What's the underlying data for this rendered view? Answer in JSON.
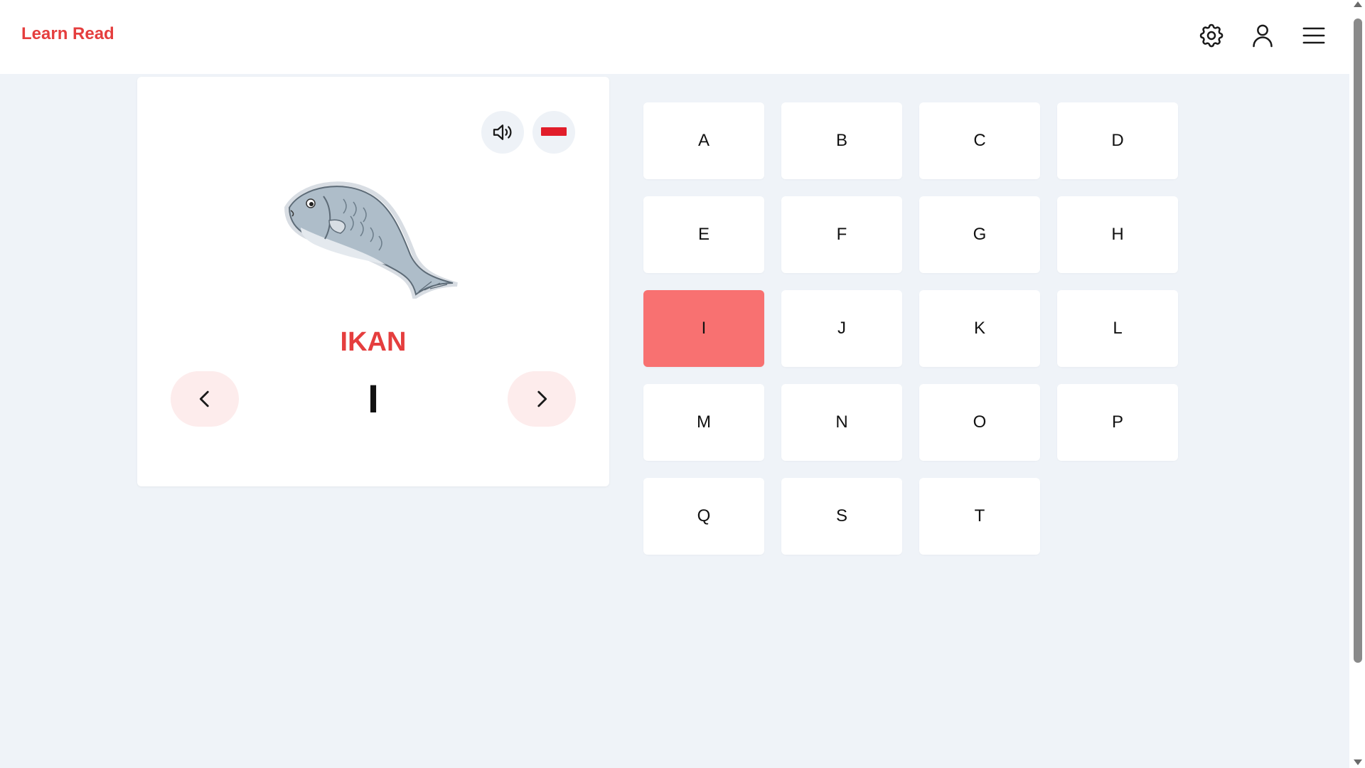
{
  "header": {
    "brand": "Learn Read",
    "icons": [
      "gear-icon",
      "user-icon",
      "menu-icon"
    ]
  },
  "card": {
    "image": "fish-illustration",
    "word": "IKAN",
    "letter": "I",
    "flag_color": "#e11d2a",
    "icons": [
      "speaker-icon",
      "flag-icon",
      "chevron-left-icon",
      "chevron-right-icon"
    ]
  },
  "letters": [
    "A",
    "B",
    "C",
    "D",
    "E",
    "F",
    "G",
    "H",
    "I",
    "J",
    "K",
    "L",
    "M",
    "N",
    "O",
    "P",
    "Q",
    "S",
    "T"
  ],
  "active_letter": "I",
  "colors": {
    "accent": "#e53e3e",
    "active_tile": "#f87171",
    "nav_button_bg": "#fdecec",
    "page_bg": "#eff3f8"
  }
}
